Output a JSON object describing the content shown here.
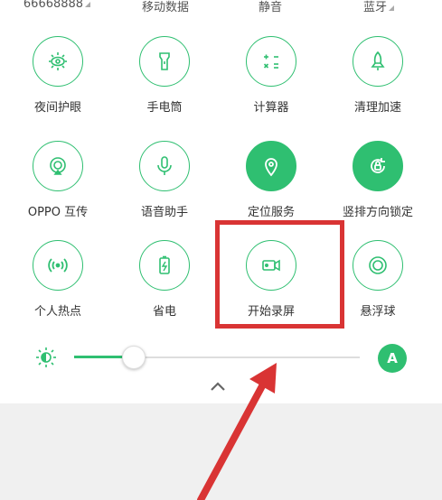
{
  "status_row": [
    "66668888",
    "移动数据",
    "静音",
    "蓝牙"
  ],
  "tiles": [
    {
      "label": "夜间护眼",
      "icon": "eye-icon",
      "active": false
    },
    {
      "label": "手电筒",
      "icon": "flashlight-icon",
      "active": false
    },
    {
      "label": "计算器",
      "icon": "calculator-icon",
      "active": false
    },
    {
      "label": "清理加速",
      "icon": "rocket-icon",
      "active": false
    },
    {
      "label": "OPPO 互传",
      "icon": "share-icon",
      "active": false
    },
    {
      "label": "语音助手",
      "icon": "microphone-icon",
      "active": false
    },
    {
      "label": "定位服务",
      "icon": "location-icon",
      "active": true
    },
    {
      "label": "竖排方向锁定",
      "icon": "rotation-lock-icon",
      "active": true
    },
    {
      "label": "个人热点",
      "icon": "hotspot-icon",
      "active": false
    },
    {
      "label": "省电",
      "icon": "battery-icon",
      "active": false
    },
    {
      "label": "开始录屏",
      "icon": "video-camera-icon",
      "active": false
    },
    {
      "label": "悬浮球",
      "icon": "floating-ball-icon",
      "active": false
    }
  ],
  "brightness": {
    "level": 0.21,
    "auto_label": "A"
  },
  "colors": {
    "accent": "#2fbf71",
    "highlight": "#d93434"
  }
}
